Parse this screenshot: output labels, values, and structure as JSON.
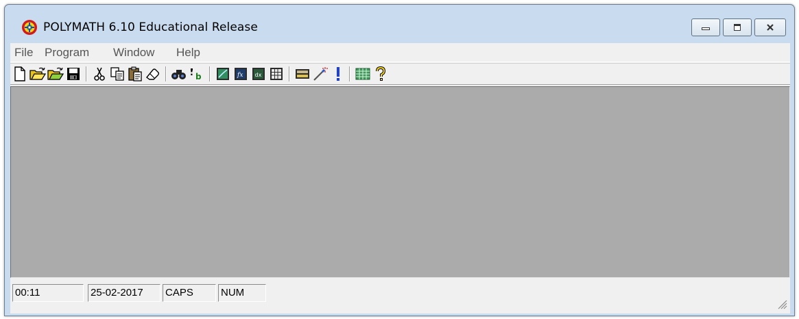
{
  "window": {
    "title": "POLYMATH 6.10 Educational Release"
  },
  "menu": {
    "items": [
      "File",
      "Program",
      "Window",
      "Help"
    ]
  },
  "toolbar": {
    "icons": [
      "new-file-icon",
      "open-folder-icon",
      "open-folder-alt-icon",
      "save-icon",
      "cut-icon",
      "copy-icon",
      "paste-icon",
      "eraser-icon",
      "find-icon",
      "replace-icon",
      "graph-icon",
      "function-icon",
      "regression-icon",
      "table-grid-icon",
      "calculator-icon",
      "wand-icon",
      "run-icon",
      "spreadsheet-icon",
      "help-icon"
    ]
  },
  "status": {
    "time": "00:11",
    "date": "25-02-2017",
    "caps": "CAPS",
    "num": "NUM"
  },
  "colors": {
    "mdi_background": "#ababab",
    "window_frame": "#c9dcef",
    "surface": "#f0f0f0"
  }
}
